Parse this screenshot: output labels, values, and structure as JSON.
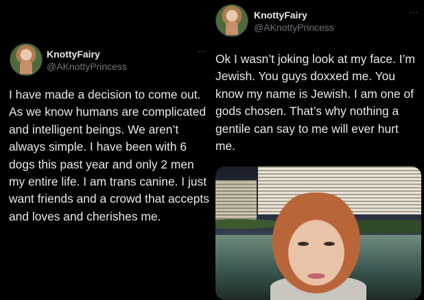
{
  "tweets": [
    {
      "display_name": "KnottyFairy",
      "handle": "@AKnottyPrincess",
      "more_icon": "...",
      "text": "I have made a decision to come out. As we know humans are complicated and intelligent beings. We aren’t always simple. I have been with 6 dogs this past year and only 2 men my entire life. I am trans canine. I just want friends and a crowd that accepts and loves and cherishes me."
    },
    {
      "display_name": "KnottyFairy",
      "handle": "@AKnottyPrincess",
      "more_icon": "...",
      "text": "Ok I wasn’t joking look at my face. I’m Jewish. You guys doxxed me. You know my name is Jewish. I am one of gods chosen. That’s why nothing a gentile can say to me will ever hurt me.",
      "has_photo": true
    }
  ],
  "colors": {
    "background": "#000000",
    "text": "#e7e9ea",
    "secondary_text": "#71767b"
  }
}
